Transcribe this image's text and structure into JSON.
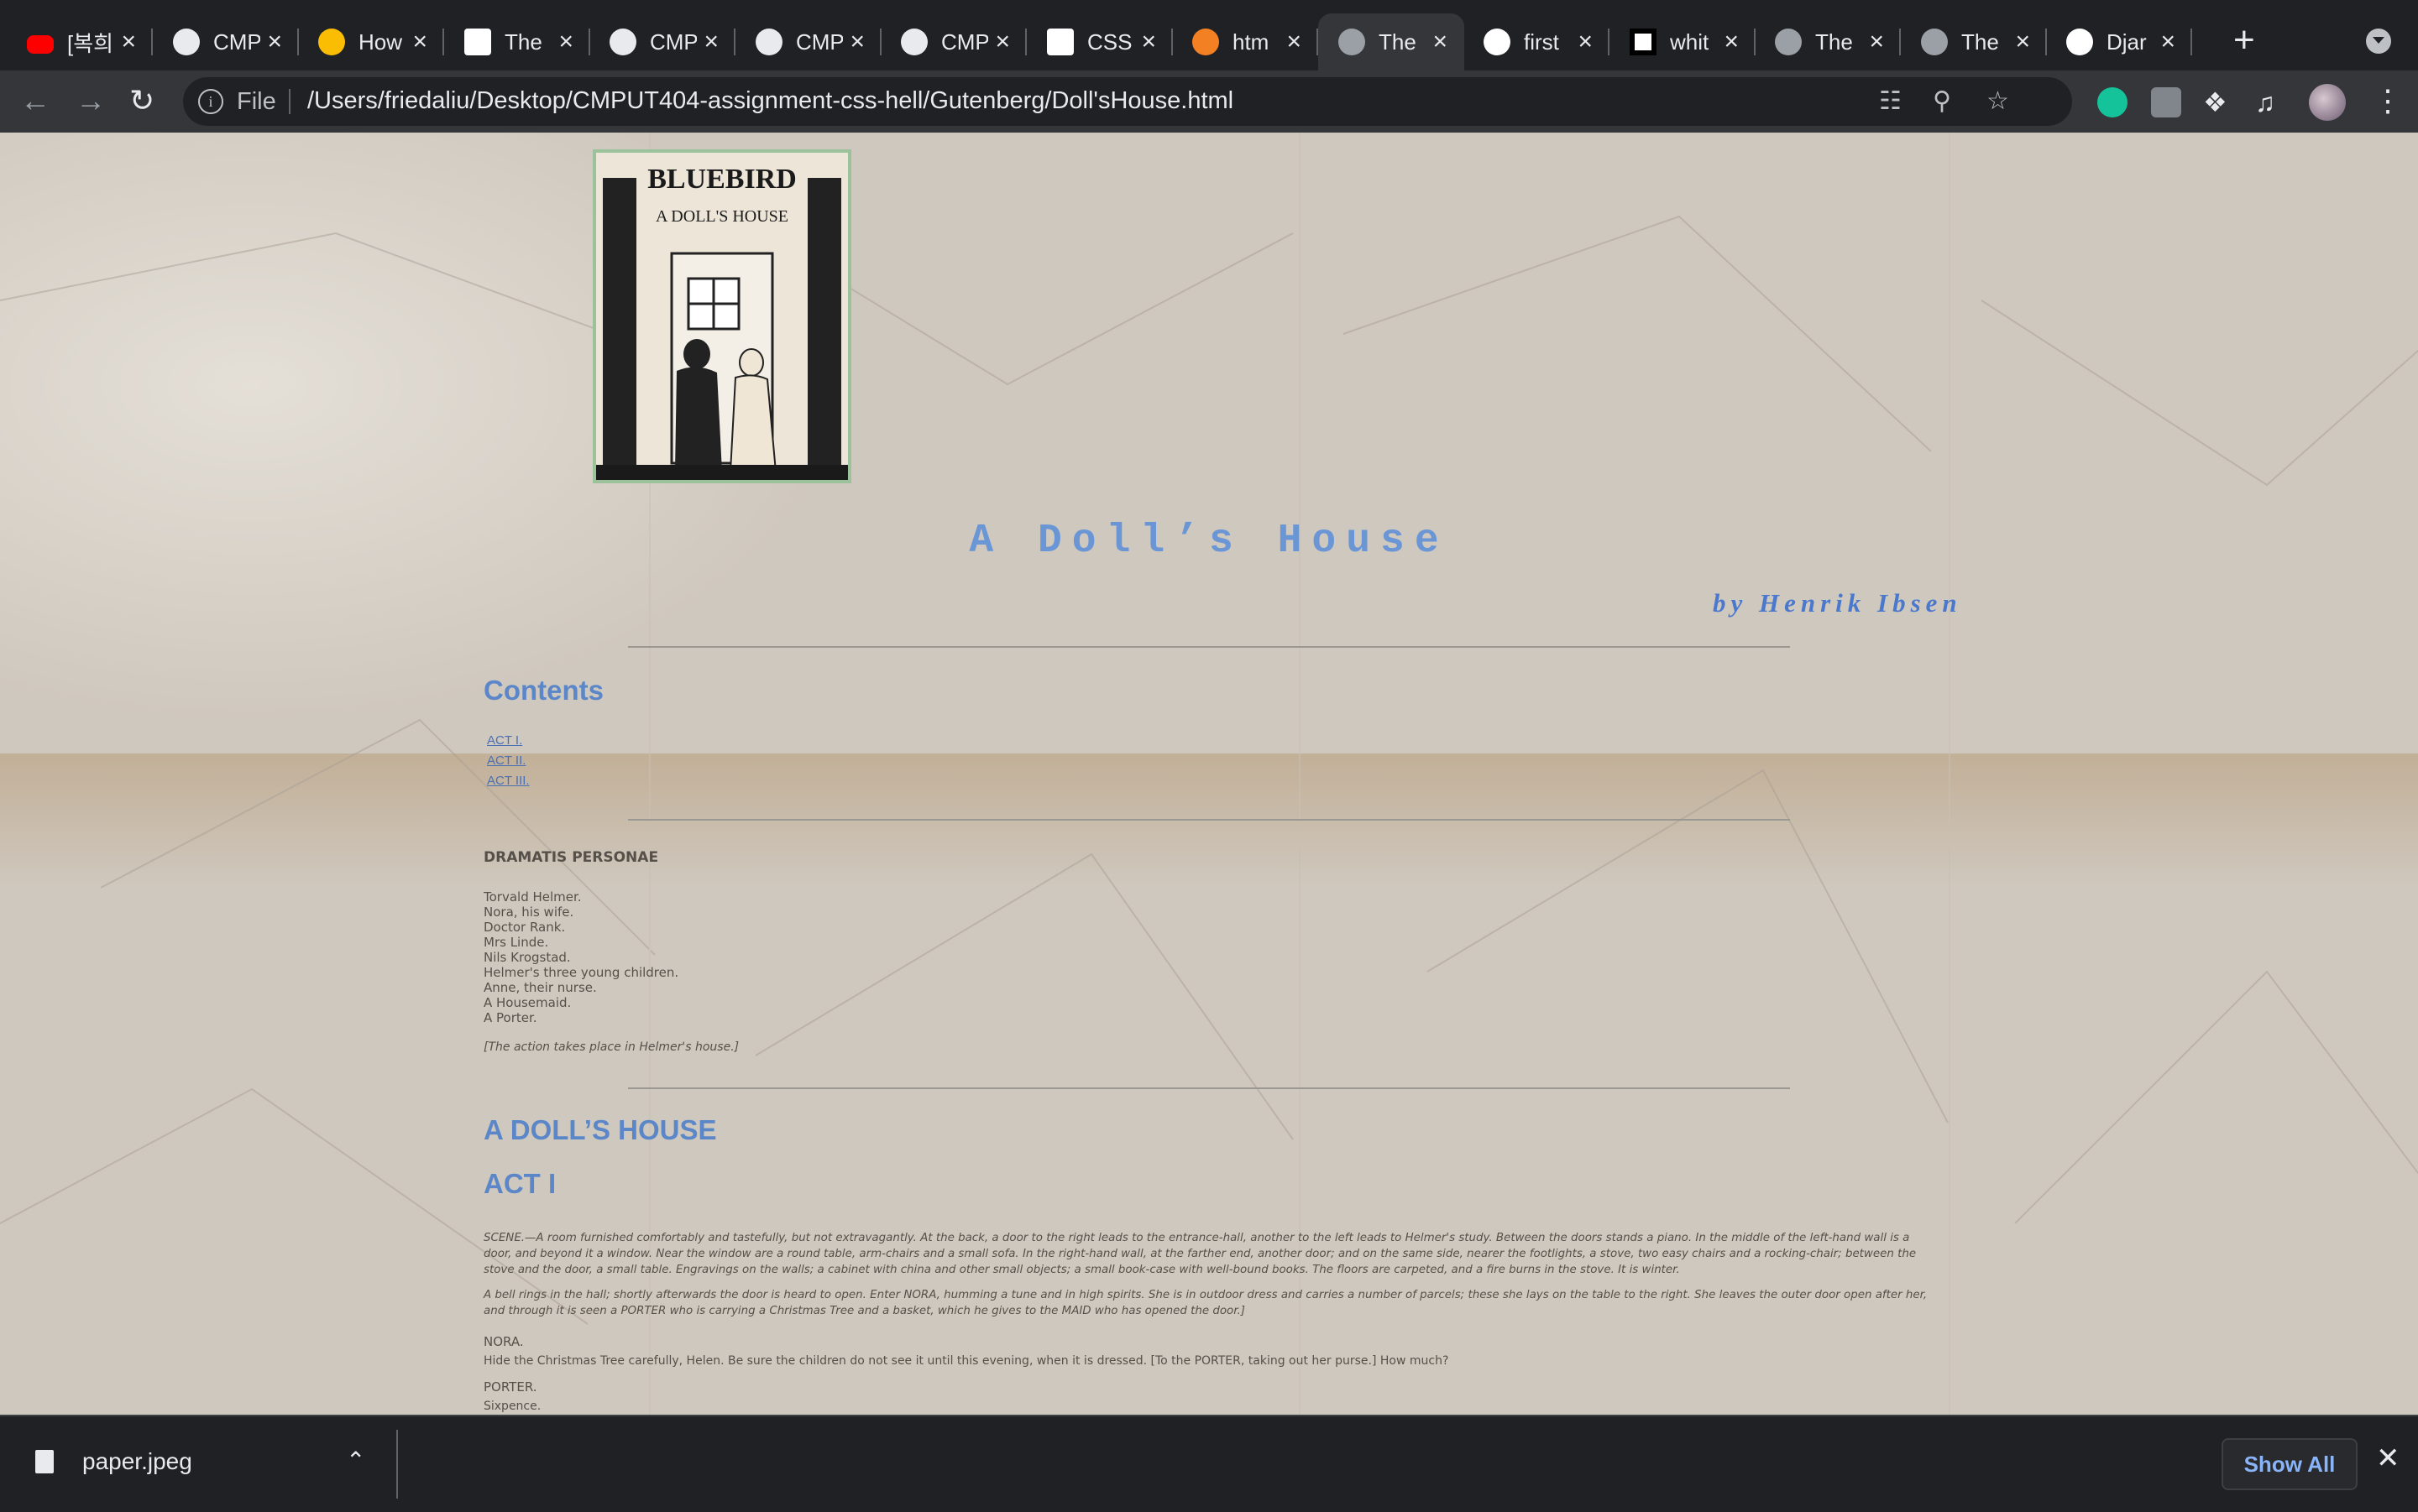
{
  "tabs": [
    {
      "title": "[복희",
      "icon": "youtube-icon"
    },
    {
      "title": "CMP",
      "icon": "github-icon"
    },
    {
      "title": "How",
      "icon": "google-photos-icon"
    },
    {
      "title": "The",
      "icon": "gutenberg-icon"
    },
    {
      "title": "CMP",
      "icon": "github-icon"
    },
    {
      "title": "CMP",
      "icon": "github-icon"
    },
    {
      "title": "CMP",
      "icon": "github-icon"
    },
    {
      "title": "CSS",
      "icon": "w3schools-icon"
    },
    {
      "title": "htm",
      "icon": "stackoverflow-icon"
    },
    {
      "title": "The",
      "icon": "globe-icon",
      "active": true
    },
    {
      "title": "first",
      "icon": "google-icon"
    },
    {
      "title": "whit",
      "icon": "unsplash-icon"
    },
    {
      "title": "The",
      "icon": "globe-icon"
    },
    {
      "title": "The",
      "icon": "globe-icon"
    },
    {
      "title": "Djar",
      "icon": "medium-icon"
    }
  ],
  "toolbar": {
    "scheme_label": "File",
    "url": "/Users/friedaliu/Desktop/CMPUT404-assignment-css-hell/Gutenberg/Doll'sHouse.html"
  },
  "page": {
    "cover_text": {
      "top": "BLUEBIRD",
      "middle": "A DOLL'S HOUSE"
    },
    "title": "A Doll’s House",
    "byline": "by Henrik Ibsen",
    "contents_heading": "Contents",
    "toc": [
      "ACT I.",
      "ACT II.",
      "ACT III."
    ],
    "dramatis_heading": "DRAMATIS PERSONAE",
    "cast": [
      "Torvald Helmer.",
      "Nora, his wife.",
      "Doctor Rank.",
      "Mrs Linde.",
      "Nils Krogstad.",
      "Helmer's three young children.",
      "Anne, their nurse.",
      "A Housemaid.",
      "A Porter."
    ],
    "setting": "[The action takes place in Helmer's house.]",
    "play_heading": "A DOLL’S HOUSE",
    "act_heading": "ACT I",
    "scene_para_1": "SCENE.—A room furnished comfortably and tastefully, but not extravagantly. At the back, a door to the right leads to the entrance-hall, another to the left leads to Helmer's study. Between the doors stands a piano. In the middle of the left-hand wall is a door, and beyond it a window. Near the window are a round table, arm-chairs and a small sofa. In the right-hand wall, at the farther end, another door; and on the same side, nearer the footlights, a stove, two easy chairs and a rocking-chair; between the stove and the door, a small table. Engravings on the walls; a cabinet with china and other small objects; a small book-case with well-bound books. The floors are carpeted, and a fire burns in the stove. It is winter.",
    "scene_para_2": "A bell rings in the hall; shortly afterwards the door is heard to open. Enter NORA, humming a tune and in high spirits. She is in outdoor dress and carries a number of parcels; these she lays on the table to the right. She leaves the outer door open after her, and through it is seen a PORTER who is carrying a Christmas Tree and a basket, which he gives to the MAID who has opened the door.]",
    "speaker_1": "NORA.",
    "line_1": "Hide the Christmas Tree carefully, Helen. Be sure the children do not see it until this evening, when it is dressed. [To the PORTER, taking out her purse.] How much?",
    "speaker_2": "PORTER.",
    "line_2": "Sixpence."
  },
  "downloads": {
    "file_name": "paper.jpeg",
    "show_all_label": "Show All"
  }
}
